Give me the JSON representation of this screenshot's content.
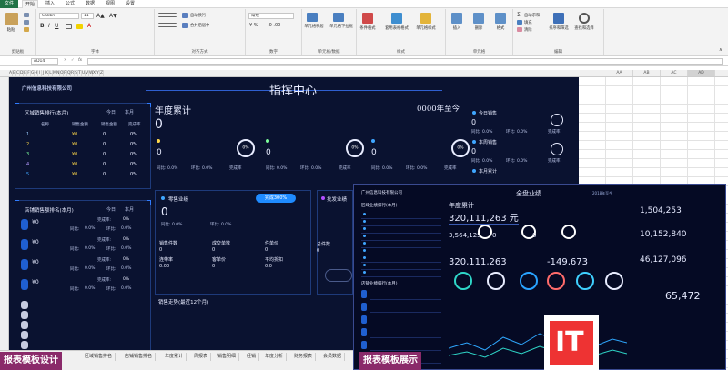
{
  "ribbon": {
    "tabs": [
      "文件",
      "开始",
      "插入",
      "公式",
      "数据",
      "视图",
      "设置"
    ],
    "active_tab": "开始",
    "font_name": "Calibri",
    "font_size": "11",
    "number_format": "常规",
    "groups": [
      "剪贴板",
      "字体",
      "对齐方式",
      "数字",
      "单元格/数据",
      "样式",
      "单元格",
      "编辑"
    ],
    "buttons": {
      "paste": "粘贴",
      "wrap": "自动换行",
      "merge": "合并后居中",
      "cond_format": "条件格式",
      "table_format": "套用表格格式",
      "cell_style": "单元格样式",
      "insert": "插入",
      "delete": "删除",
      "format": "格式",
      "sort": "排序和筛选",
      "find": "查找和选择",
      "sum": "自动求和",
      "fill": "填充",
      "clear": "清除",
      "cells_btn1": "单元格移居",
      "cells_btn2": "单元格下拉框"
    }
  },
  "formula_bar": {
    "name_box": "AD14",
    "content": ""
  },
  "columns": [
    "A",
    "B",
    "C",
    "D",
    "E",
    "F",
    "G",
    "H",
    "I",
    "J",
    "K",
    "L",
    "M",
    "N",
    "O",
    "P",
    "Q",
    "R",
    "S",
    "T",
    "U",
    "V",
    "W",
    "X",
    "Y",
    "Z",
    "AA",
    "AB",
    "AC",
    "AD"
  ],
  "dashboard": {
    "company": "广州信息科技有限公司",
    "title": "指挥中心",
    "year_label": "年度累计",
    "year_value": "0",
    "year_range": "0000年至今",
    "region_rank_title": "区域销售排行(本月)",
    "period_today": "今日",
    "period_month": "本月",
    "region_cols": [
      "名称",
      "销售金额",
      "销售金额",
      "完成率"
    ],
    "region_rows": [
      {
        "rank": "1",
        "amt1": "¥0",
        "amt2": "0",
        "rate": "0%"
      },
      {
        "rank": "2",
        "amt1": "¥0",
        "amt2": "0",
        "rate": "0%"
      },
      {
        "rank": "3",
        "amt1": "¥0",
        "amt2": "0",
        "rate": "0%"
      },
      {
        "rank": "4",
        "amt1": "¥0",
        "amt2": "0",
        "rate": "0%"
      },
      {
        "rank": "5",
        "amt1": "¥0",
        "amt2": "0",
        "rate": "0%"
      }
    ],
    "store_rank_title": "店铺销售额排名(本月)",
    "store_rows": [
      {
        "value": "¥0",
        "rate_label": "完成率:",
        "rate": "0%",
        "yoy_label": "同比:",
        "yoy": "0.0%",
        "mom_label": "环比:",
        "mom": "0.0%"
      },
      {
        "value": "¥0",
        "rate_label": "完成率:",
        "rate": "0%",
        "yoy_label": "同比:",
        "yoy": "0.0%",
        "mom_label": "环比:",
        "mom": "0.0%"
      },
      {
        "value": "¥0",
        "rate_label": "完成率:",
        "rate": "0%",
        "yoy_label": "同比:",
        "yoy": "0.0%",
        "mom_label": "环比:",
        "mom": "0.0%"
      },
      {
        "value": "¥0",
        "rate_label": "完成率:",
        "rate": "0%",
        "yoy_label": "同比:",
        "yoy": "0.0%",
        "mom_label": "环比:",
        "mom": "0.0%"
      }
    ],
    "mid_metrics": [
      {
        "value": "0",
        "yoy": "同比: 0.0%",
        "mom": "环比: 0.0%",
        "rate_label": "完成率",
        "ring": "0%"
      },
      {
        "value": "0",
        "yoy": "同比: 0.0%",
        "mom": "环比: 0.0%",
        "rate_label": "完成率",
        "ring": "0%"
      },
      {
        "value": "0",
        "yoy": "同比: 0.0%",
        "mom": "环比: 0.0%",
        "rate_label": "完成率",
        "ring": "0%"
      }
    ],
    "right_list": [
      {
        "label": "今日销售",
        "value": "0",
        "yoy": "同比: 0.0%",
        "mom": "环比: 0.0%",
        "rate": "完成率"
      },
      {
        "label": "本周销售",
        "value": "0",
        "yoy": "同比: 0.0%",
        "mom": "环比: 0.0%",
        "rate": "完成率"
      },
      {
        "label": "本月累计",
        "value": "",
        "yoy": "",
        "mom": "",
        "rate": ""
      }
    ],
    "perf_card": {
      "title": "零售业绩",
      "button": "完成300%",
      "value": "0",
      "yoy": "同比: 0.0%",
      "mom": "环比: 0.0%"
    },
    "perf_card2": {
      "title": "批发业绩"
    },
    "stats_labels": [
      "销售件数",
      "成交单数",
      "件单价",
      "总件数",
      "连带率",
      "客单价",
      "平均折扣"
    ],
    "stats_values": [
      "0",
      "0",
      "0",
      "0",
      "0.00",
      "0",
      "0.0"
    ],
    "trend_title": "销售走势(最近12个月)"
  },
  "inset": {
    "company": "广州信息科技有限公司",
    "title": "全盘业绩",
    "date": "2018年至今",
    "region_title": "区域业绩排行(本月)",
    "year_label": "年度累计",
    "year_value": "320,111,263 元",
    "big1": "320,111,263",
    "big2": "-149,673",
    "sub_values": [
      "1,504,253",
      "10,152,840",
      "46,127,096"
    ],
    "kpi": "65,472",
    "small_values": [
      "3,564,125",
      "0",
      "0"
    ],
    "store_title": "店铺业绩排行(本月)"
  },
  "sheets": [
    "报表模板设计",
    "区域销售排名",
    "店铺销售排名",
    "年度累计",
    "周报表",
    "销售明细",
    "经销",
    "年度分析",
    "财务报表",
    "会员数据"
  ],
  "watermarks": {
    "left": "报表模板设计",
    "right": "报表模板展示"
  },
  "brand": "IT"
}
